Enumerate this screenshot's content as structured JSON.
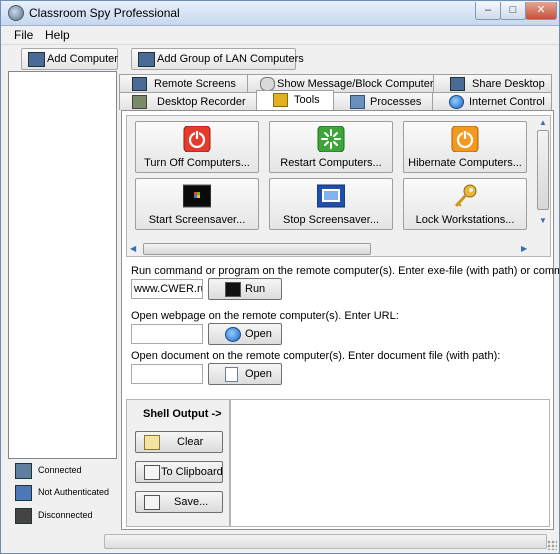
{
  "window": {
    "title": "Classroom Spy Professional",
    "controls": {
      "minimize": "–",
      "maximize": "□",
      "close": "✕"
    }
  },
  "menu": {
    "items": [
      "File",
      "Help"
    ]
  },
  "toolbar": {
    "add_computer": "Add Computer",
    "add_group": "Add Group of LAN Computers"
  },
  "legend": {
    "connected": "Connected",
    "not_authenticated": "Not Authenticated",
    "disconnected": "Disconnected"
  },
  "tabs": {
    "row1": [
      "Remote Screens",
      "Show Message/Block Computers",
      "Share Desktop"
    ],
    "row2": [
      "Desktop Recorder",
      "Tools",
      "Processes",
      "Internet Control"
    ],
    "active": "Tools"
  },
  "tools": {
    "turn_off": "Turn Off Computers...",
    "restart": "Restart Computers...",
    "hibernate": "Hibernate Computers...",
    "start_screensaver": "Start Screensaver...",
    "stop_screensaver": "Stop Screensaver...",
    "lock": "Lock Workstations..."
  },
  "run_command": {
    "label": "Run command or program on the remote computer(s). Enter exe-file (with path) or command:",
    "value": "www.CWER.ru",
    "button": "Run"
  },
  "open_webpage": {
    "label": "Open webpage on the remote computer(s). Enter URL:",
    "value": "",
    "button": "Open"
  },
  "open_document": {
    "label": "Open document on the remote computer(s). Enter document file (with path):",
    "value": "",
    "button": "Open"
  },
  "shell": {
    "title": "Shell Output ->",
    "clear": "Clear",
    "clipboard": "To Clipboard",
    "save": "Save..."
  },
  "icons": {
    "app": "spy-icon",
    "add_computer": "add-computer-icon",
    "add_group": "add-group-icon",
    "power": "power-icon",
    "restart": "restart-icon",
    "hibernate": "hibernate-icon",
    "screensaver": "screensaver-icon",
    "stop_screensaver": "stop-screensaver-icon",
    "lock": "key-icon"
  },
  "colors": {
    "title_gradient_top": "#e9f1fb",
    "title_gradient_bottom": "#c6d7ee",
    "power_red": "#e53b2c",
    "restart_green": "#3da53a",
    "hibernate_orange": "#f39a1e",
    "accent_blue": "#3a6db0"
  }
}
